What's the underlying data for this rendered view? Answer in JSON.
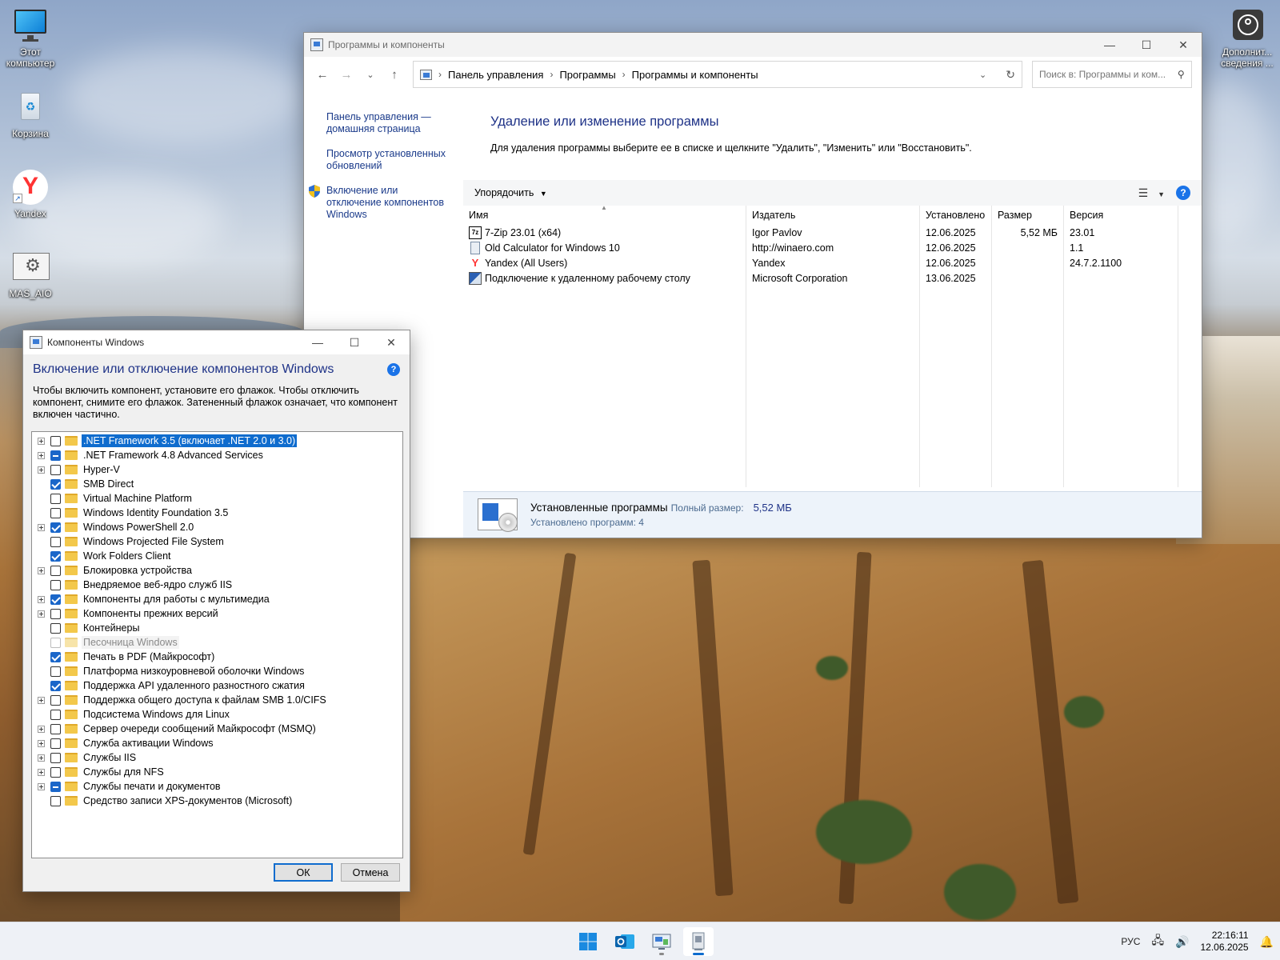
{
  "desktop": {
    "icons": [
      {
        "label": "Этот компьютер"
      },
      {
        "label": "Корзина"
      },
      {
        "label": "Yandex"
      },
      {
        "label": "MAS_AIO"
      },
      {
        "label": "Дополнит... сведения ..."
      }
    ]
  },
  "cp_window": {
    "title": "Программы и компоненты",
    "breadcrumb": [
      "Панель управления",
      "Программы",
      "Программы и компоненты"
    ],
    "search_placeholder": "Поиск в: Программы и ком...",
    "left_links": [
      "Панель управления — домашняя страница",
      "Просмотр установленных обновлений",
      "Включение или отключение компонентов Windows"
    ],
    "heading": "Удаление или изменение программы",
    "subtext": "Для удаления программы выберите ее в списке и щелкните \"Удалить\", \"Изменить\" или \"Восстановить\".",
    "organize_label": "Упорядочить",
    "columns": [
      "Имя",
      "Издатель",
      "Установлено",
      "Размер",
      "Версия"
    ],
    "programs": [
      {
        "name": "7-Zip 23.01 (x64)",
        "publisher": "Igor Pavlov",
        "installed": "12.06.2025",
        "size": "5,52 МБ",
        "version": "23.01",
        "icon": "7zip-icon"
      },
      {
        "name": "Old Calculator for Windows 10",
        "publisher": "http://winaero.com",
        "installed": "12.06.2025",
        "size": "",
        "version": "1.1",
        "icon": "calculator-icon"
      },
      {
        "name": "Yandex (All Users)",
        "publisher": "Yandex",
        "installed": "12.06.2025",
        "size": "",
        "version": "24.7.2.1100",
        "icon": "yandex-icon"
      },
      {
        "name": "Подключение к удаленному рабочему столу",
        "publisher": "Microsoft Corporation",
        "installed": "13.06.2025",
        "size": "",
        "version": "",
        "icon": "remote-desktop-icon"
      }
    ],
    "status": {
      "title": "Установленные программы",
      "total_label": "Полный размер:",
      "total_value": "5,52 МБ",
      "count_text": "Установлено программ: 4"
    }
  },
  "features_window": {
    "title": "Компоненты Windows",
    "heading": "Включение или отключение компонентов Windows",
    "description": "Чтобы включить компонент, установите его флажок. Чтобы отключить компонент, снимите его флажок. Затененный флажок означает, что компонент включен частично.",
    "items": [
      {
        "label": ".NET Framework 3.5 (включает .NET 2.0 и 3.0)",
        "expandable": true,
        "state": "off",
        "selected": true
      },
      {
        "label": ".NET Framework 4.8 Advanced Services",
        "expandable": true,
        "state": "partial"
      },
      {
        "label": "Hyper-V",
        "expandable": true,
        "state": "off"
      },
      {
        "label": "SMB Direct",
        "expandable": false,
        "state": "on"
      },
      {
        "label": "Virtual Machine Platform",
        "expandable": false,
        "state": "off"
      },
      {
        "label": "Windows Identity Foundation 3.5",
        "expandable": false,
        "state": "off"
      },
      {
        "label": "Windows PowerShell 2.0",
        "expandable": true,
        "state": "on"
      },
      {
        "label": "Windows Projected File System",
        "expandable": false,
        "state": "off"
      },
      {
        "label": "Work Folders Client",
        "expandable": false,
        "state": "on"
      },
      {
        "label": "Блокировка устройства",
        "expandable": true,
        "state": "off"
      },
      {
        "label": "Внедряемое веб-ядро служб IIS",
        "expandable": false,
        "state": "off"
      },
      {
        "label": "Компоненты для работы с мультимедиа",
        "expandable": true,
        "state": "on"
      },
      {
        "label": "Компоненты прежних версий",
        "expandable": true,
        "state": "off"
      },
      {
        "label": "Контейнеры",
        "expandable": false,
        "state": "off"
      },
      {
        "label": "Песочница Windows",
        "expandable": false,
        "state": "disabled"
      },
      {
        "label": "Печать в PDF (Майкрософт)",
        "expandable": false,
        "state": "on"
      },
      {
        "label": "Платформа низкоуровневой оболочки Windows",
        "expandable": false,
        "state": "off"
      },
      {
        "label": "Поддержка API удаленного разностного сжатия",
        "expandable": false,
        "state": "on"
      },
      {
        "label": "Поддержка общего доступа к файлам SMB 1.0/CIFS",
        "expandable": true,
        "state": "off"
      },
      {
        "label": "Подсистема Windows для Linux",
        "expandable": false,
        "state": "off"
      },
      {
        "label": "Сервер очереди сообщений Майкрософт (MSMQ)",
        "expandable": true,
        "state": "off"
      },
      {
        "label": "Служба активации Windows",
        "expandable": true,
        "state": "off"
      },
      {
        "label": "Службы IIS",
        "expandable": true,
        "state": "off"
      },
      {
        "label": "Службы для NFS",
        "expandable": true,
        "state": "off"
      },
      {
        "label": "Службы печати и документов",
        "expandable": true,
        "state": "partial"
      },
      {
        "label": "Средство записи XPS-документов (Microsoft)",
        "expandable": false,
        "state": "off"
      }
    ],
    "ok_label": "ОК",
    "cancel_label": "Отмена"
  },
  "taskbar": {
    "apps": [
      "windows-start-icon",
      "outlook-icon",
      "control-panel-icon",
      "programs-features-icon"
    ],
    "language": "РУС",
    "time": "22:16:11",
    "date": "12.06.2025"
  },
  "colors": {
    "accent": "#0f6cce",
    "heading_blue": "#1e3287",
    "link_blue": "#1a3a8a"
  }
}
